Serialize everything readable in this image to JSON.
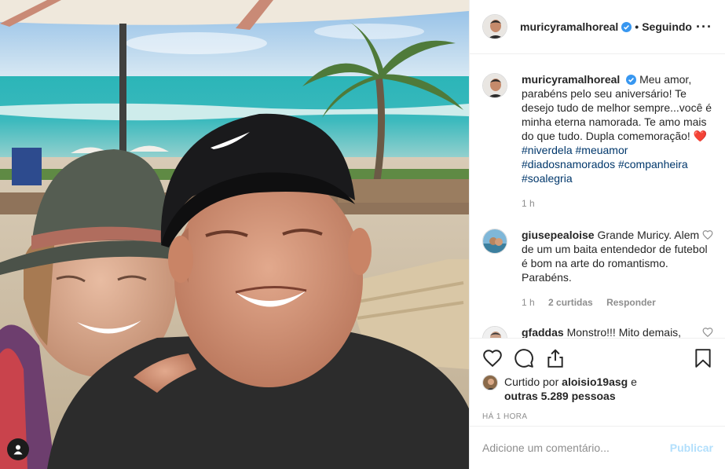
{
  "post": {
    "author": "muricyramalhoreal",
    "follow_state": "Seguindo",
    "more_icon": "more-icon",
    "caption_parts": {
      "text": "Meu amor, parabéns pelo seu aniversário! Te desejo tudo de melhor sempre...você é minha eterna namorada. Te amo mais do que tudo. Dupla comemoração! ",
      "emoji": "❤️",
      "hashtags": [
        "#niverdela",
        "#meuamor",
        "#diadosnamorados",
        "#companheira",
        "#soalegria"
      ]
    },
    "caption_time": "1 h"
  },
  "comments": [
    {
      "user": "giusepealoise",
      "text": "Grande Muricy. Alem de um um baita entendedor de futebol é bom na arte do romantismo. Parabéns.",
      "time": "1 h",
      "likes": "2 curtidas",
      "reply": "Responder"
    },
    {
      "user": "gfaddas",
      "text": "Monstro!!! Mito demais,"
    }
  ],
  "likes": {
    "prefix": "Curtido por",
    "user": "aloisio19asg",
    "connector": "e",
    "others": "outras 5.289 pessoas"
  },
  "timestamp": "HÁ 1 HORA",
  "composer": {
    "placeholder": "Adicione um comentário...",
    "publish_label": "Publicar"
  },
  "colors": {
    "link": "#00376b",
    "muted": "#8e8e8e",
    "publish_disabled": "#b2dffc",
    "verified": "#3897f0"
  }
}
